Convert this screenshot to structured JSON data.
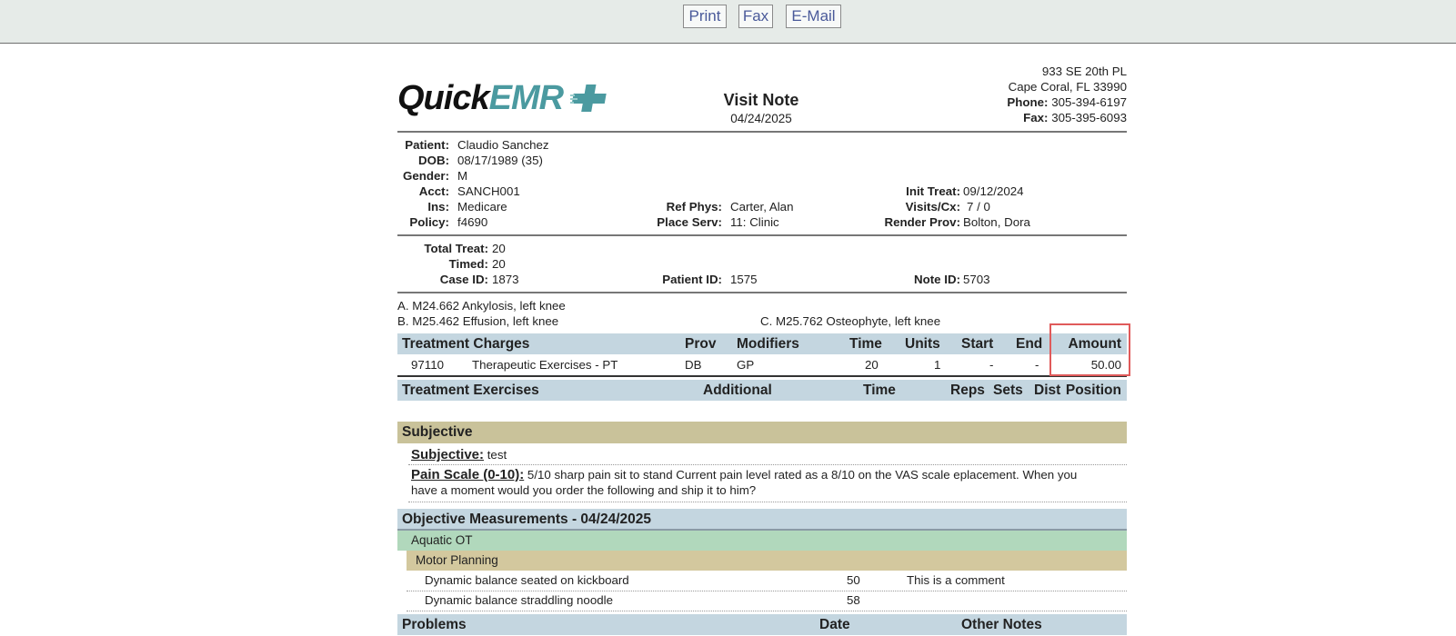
{
  "toolbar": {
    "print": "Print",
    "fax": "Fax",
    "email": "E-Mail"
  },
  "header": {
    "logo_part1": "Quick",
    "logo_part2": "EMR",
    "title": "Visit Note",
    "date": "04/24/2025",
    "address_line1": "933 SE 20th PL",
    "address_line2": "Cape Coral, FL 33990",
    "phone_label": "Phone:",
    "phone": "305-394-6197",
    "fax_label": "Fax:",
    "fax": "305-395-6093"
  },
  "patient": {
    "patient_label": "Patient:",
    "patient": "Claudio Sanchez",
    "dob_label": "DOB:",
    "dob": "08/17/1989 (35)",
    "gender_label": "Gender:",
    "gender": "M",
    "acct_label": "Acct:",
    "acct": "SANCH001",
    "ins_label": "Ins:",
    "ins": "Medicare",
    "policy_label": "Policy:",
    "policy": "f4690",
    "refphys_label": "Ref Phys:",
    "refphys": "Carter, Alan",
    "placeserv_label": "Place Serv:",
    "placeserv": "11: Clinic",
    "inittreat_label": "Init Treat:",
    "inittreat": "09/12/2024",
    "visits_label": "Visits/Cx:",
    "visits": "7 / 0",
    "renderprov_label": "Render Prov:",
    "renderprov": "Bolton, Dora"
  },
  "totals": {
    "totaltreat_label": "Total Treat:",
    "totaltreat": "20",
    "timed_label": "Timed:",
    "timed": "20",
    "caseid_label": "Case ID:",
    "caseid": "1873",
    "patientid_label": "Patient ID:",
    "patientid": "1575",
    "noteid_label": "Note ID:",
    "noteid": "5703"
  },
  "diagnoses": {
    "a": "A. M24.662 Ankylosis, left knee",
    "b": "B. M25.462 Effusion, left knee",
    "c": "C. M25.762 Osteophyte, left knee"
  },
  "charges": {
    "headers": [
      "Treatment Charges",
      "Prov",
      "Modifiers",
      "Time",
      "Units",
      "Start",
      "End",
      "Amount"
    ],
    "row": [
      "97110",
      "Therapeutic Exercises - PT",
      "DB",
      "GP",
      "20",
      "1",
      "-",
      "-",
      "50.00"
    ]
  },
  "exercises": {
    "headers": [
      "Treatment Exercises",
      "Additional",
      "Time",
      "Reps",
      "Sets",
      "Dist",
      "Position"
    ]
  },
  "subjective": {
    "section": "Subjective",
    "subj_label": "Subjective:",
    "subj_value": "test",
    "pain_label": "Pain Scale (0-10):",
    "pain_value_1": "5/10 sharp pain sit to stand Current pain level rated as a 8/10 on the VAS scale eplacement. When you",
    "pain_value_2": "have a moment would you order the following and ship it to him?"
  },
  "objective": {
    "section": "Objective Measurements - 04/24/2025",
    "group": "Aquatic OT",
    "subgroup": "Motor Planning",
    "items": [
      {
        "name": "Dynamic balance seated on kickboard",
        "value": "50",
        "comment": "This is a comment"
      },
      {
        "name": "Dynamic balance straddling noodle",
        "value": "58",
        "comment": ""
      }
    ]
  },
  "problems": {
    "headers": [
      "Problems",
      "Date",
      "Other Notes"
    ]
  }
}
